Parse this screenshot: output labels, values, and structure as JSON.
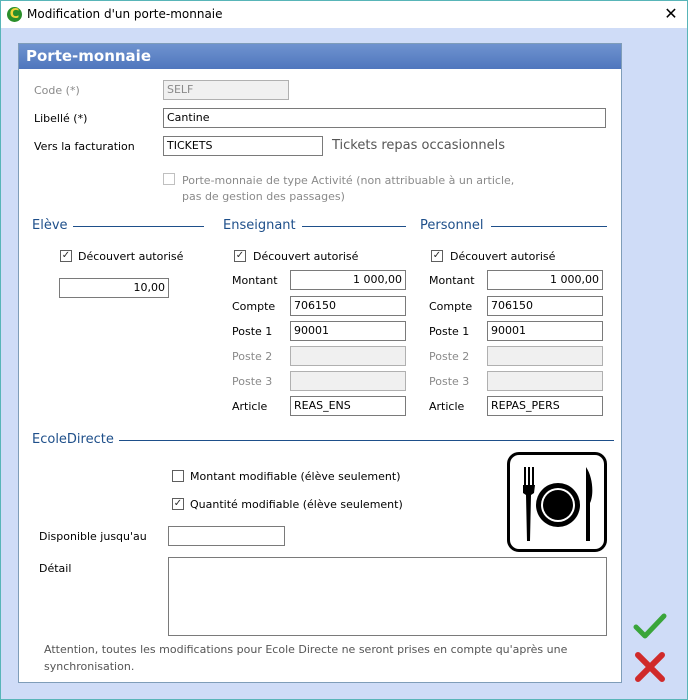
{
  "window": {
    "title": "Modification d'un porte-monnaie"
  },
  "panel": {
    "header": "Porte-monnaie"
  },
  "form": {
    "code_label": "Code (*)",
    "code_value": "SELF",
    "libelle_label": "Libellé (*)",
    "libelle_value": "Cantine",
    "facturation_label": "Vers la facturation",
    "facturation_value": "TICKETS",
    "facturation_desc": "Tickets repas occasionnels",
    "activite_label_line1": "Porte-monnaie de type Activité (non attribuable à un article,",
    "activite_label_line2": "pas de gestion des passages)",
    "activite_checked": false
  },
  "eleve": {
    "title": "Elève",
    "decouvert_label": "Découvert autorisé",
    "decouvert_checked": true,
    "montant_value": "10,00"
  },
  "enseignant": {
    "title": "Enseignant",
    "decouvert_label": "Découvert autorisé",
    "decouvert_checked": true,
    "montant_label": "Montant",
    "montant_value": "1 000,00",
    "compte_label": "Compte",
    "compte_value": "706150",
    "poste1_label": "Poste 1",
    "poste1_value": "90001",
    "poste2_label": "Poste 2",
    "poste2_value": "",
    "poste3_label": "Poste 3",
    "poste3_value": "",
    "article_label": "Article",
    "article_value": "REAS_ENS"
  },
  "personnel": {
    "title": "Personnel",
    "decouvert_label": "Découvert autorisé",
    "decouvert_checked": true,
    "montant_label": "Montant",
    "montant_value": "1 000,00",
    "compte_label": "Compte",
    "compte_value": "706150",
    "poste1_label": "Poste 1",
    "poste1_value": "90001",
    "poste2_label": "Poste 2",
    "poste2_value": "",
    "poste3_label": "Poste 3",
    "poste3_value": "",
    "article_label": "Article",
    "article_value": "REPAS_PERS"
  },
  "ecoledirecte": {
    "title": "EcoleDirecte",
    "montant_modifiable_label": "Montant modifiable (élève seulement)",
    "montant_modifiable_checked": false,
    "quantite_modifiable_label": "Quantité modifiable (élève seulement)",
    "quantite_modifiable_checked": true,
    "disponible_label": "Disponible jusqu'au",
    "disponible_value": "",
    "detail_label": "Détail",
    "detail_value": "",
    "note_line1": "Attention, toutes les modifications pour Ecole Directe ne seront prises en compte qu'après une",
    "note_line2": "synchronisation."
  },
  "icons": {
    "app": "app-logo-icon",
    "close": "close-icon",
    "meal": "meal-plate-icon",
    "validate": "checkmark-icon",
    "cancel": "cross-icon"
  },
  "colors": {
    "accent": "#1e4f8a",
    "header": "#5b80c4",
    "window_bg": "#cfdcf7",
    "validate": "#3aa53a",
    "cancel": "#d02a2a"
  }
}
